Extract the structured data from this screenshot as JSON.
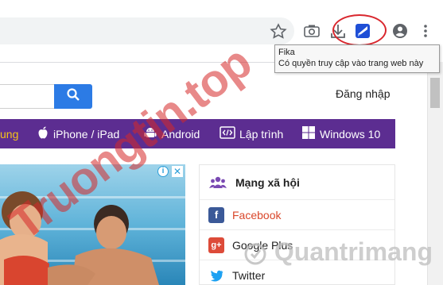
{
  "extension_tooltip": {
    "name": "Fika",
    "description": "Có quyền truy cập vào trang web này"
  },
  "icons": {
    "bookmark": "star-icon",
    "screenshot": "camera-icon",
    "download": "download-icon",
    "extension": "fika-extension-icon",
    "profile": "account-icon",
    "menu": "three-dot-menu-icon"
  },
  "header": {
    "login_label": "Đăng nhập"
  },
  "nav": {
    "items": [
      {
        "label": "ung",
        "icon": ""
      },
      {
        "label": "iPhone / iPad",
        "icon": "apple-icon"
      },
      {
        "label": "Android",
        "icon": "android-icon"
      },
      {
        "label": "Lập trình",
        "icon": "code-icon"
      },
      {
        "label": "Windows 10",
        "icon": "windows-icon"
      }
    ]
  },
  "sidebar_social": {
    "title": "Mạng xã hội",
    "items": [
      {
        "label": "Facebook",
        "color": "#d9472b"
      },
      {
        "label": "Google Plus",
        "color": "#222222"
      },
      {
        "label": "Twitter",
        "color": "#222222"
      }
    ]
  },
  "watermarks": {
    "left": "Truongtin.top",
    "right": "Quantrimang"
  },
  "colors": {
    "nav_background": "#5c2d91",
    "search_button": "#2c7be5",
    "highlight": "#d9272e",
    "facebook": "#3b5998",
    "google_plus": "#dd4b39",
    "twitter": "#1da1f2"
  }
}
